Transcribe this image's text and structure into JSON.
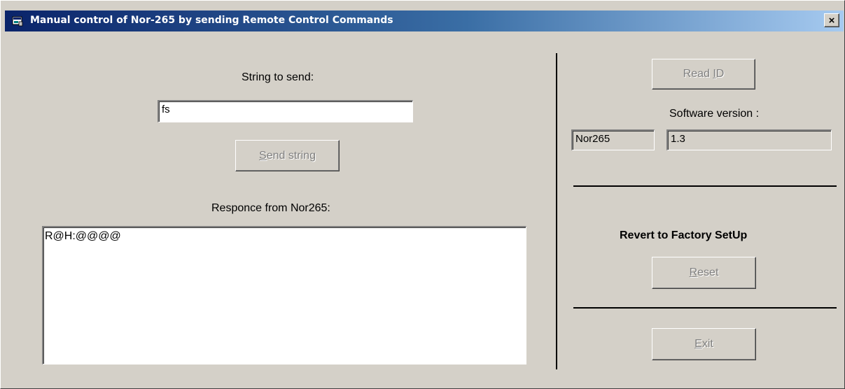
{
  "window": {
    "title": "Manual control of Nor-265 by sending Remote Control Commands",
    "close_label": "×"
  },
  "left": {
    "string_label": "String to send:",
    "string_value": "fs",
    "send_button": {
      "mnemonic": "S",
      "rest": "end string"
    },
    "response_label": "Responce from Nor265:",
    "response_value": "R@H:@@@@"
  },
  "right": {
    "read_id_button": {
      "prefix": "Read ",
      "mnemonic": "I",
      "rest": "D"
    },
    "software_version_label": "Software version :",
    "device_value": "Nor265",
    "version_value": "1.3",
    "factory_label": "Revert to Factory SetUp",
    "reset_button": {
      "mnemonic": "R",
      "rest": "eset"
    },
    "exit_button": {
      "mnemonic": "E",
      "rest": "xit"
    }
  },
  "colors": {
    "face": "#d4d0c8",
    "title_start": "#0a246a",
    "title_end": "#a6caf0",
    "disabled_text": "#808080"
  }
}
